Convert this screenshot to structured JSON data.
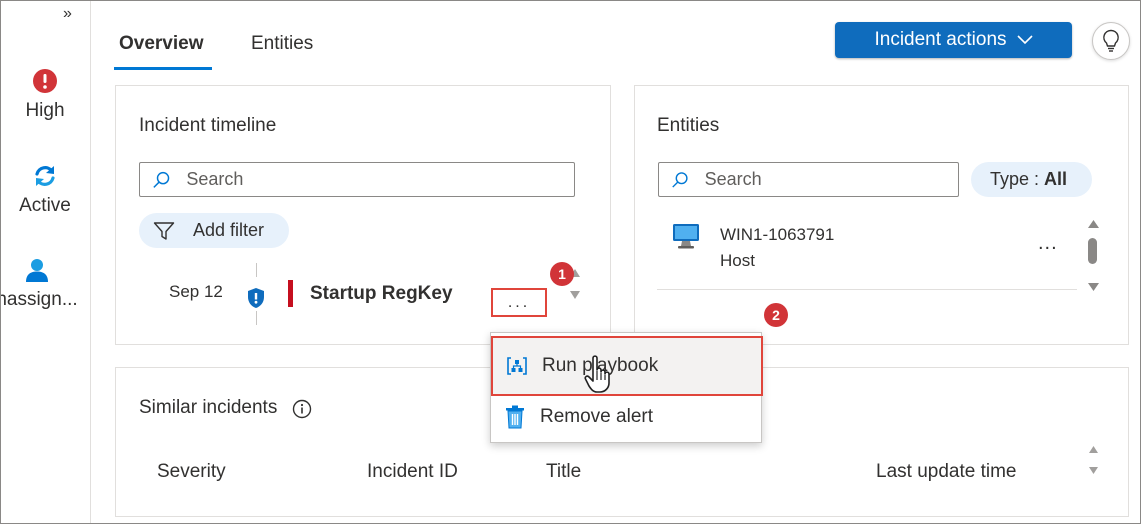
{
  "rail": {
    "expand_glyph": "»",
    "items": [
      {
        "label": "High",
        "icon": "alert-icon",
        "color": "#d13438"
      },
      {
        "label": "Active",
        "icon": "refresh-icon",
        "color": "#0078d4"
      },
      {
        "label": "nassign...",
        "icon": "person-icon",
        "color": "#0078d4"
      }
    ]
  },
  "tabs": [
    {
      "label": "Overview",
      "selected": true
    },
    {
      "label": "Entities",
      "selected": false
    }
  ],
  "header": {
    "actions_label": "Incident actions",
    "accent": "#0f6cbd"
  },
  "timeline": {
    "title": "Incident timeline",
    "search_placeholder": "Search",
    "add_filter_label": "Add filter",
    "event": {
      "date": "Sep 12",
      "title": "Startup RegKey",
      "severity_color": "#c50f1f",
      "more_label": "..."
    }
  },
  "entities": {
    "title": "Entities",
    "search_placeholder": "Search",
    "type_label": "Type : ",
    "type_value": "All",
    "items": [
      {
        "name": "WIN1-1063791",
        "type": "Host",
        "more_label": "..."
      }
    ]
  },
  "menu": {
    "items": [
      {
        "label": "Run playbook",
        "icon": "playbook-icon"
      },
      {
        "label": "Remove alert",
        "icon": "trash-icon"
      }
    ]
  },
  "similar": {
    "title": "Similar incidents",
    "columns": [
      "Severity",
      "Incident ID",
      "Title",
      "Last update time"
    ]
  },
  "callouts": [
    "1",
    "2"
  ]
}
